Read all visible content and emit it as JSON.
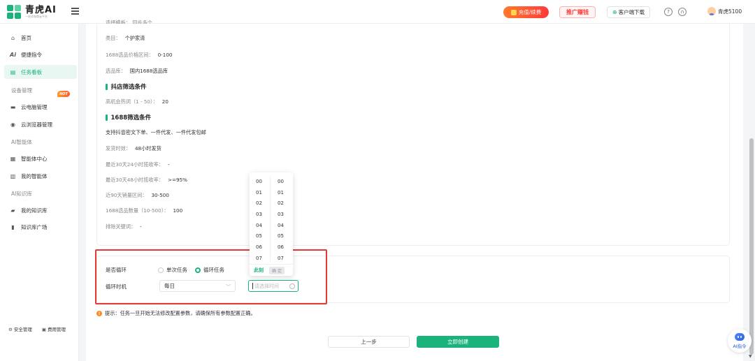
{
  "brand": {
    "title": "青虎AI",
    "subtitle": "一站式电商云平台"
  },
  "topbar": {
    "recharge": "充值/续费",
    "promo": "推广赚钱",
    "download": "客户端下载",
    "user": "青虎5100"
  },
  "sidebar": {
    "items": [
      {
        "label": "首页",
        "icon": "home-icon"
      },
      {
        "label": "便捷指令",
        "icon": "ai-command-icon"
      },
      {
        "label": "任务看板",
        "icon": "task-board-icon",
        "active": true
      }
    ],
    "section_device": "设备管理",
    "device_items": [
      {
        "label": "云电脑管理",
        "icon": "monitor-icon"
      },
      {
        "label": "云浏览器管理",
        "icon": "browser-icon"
      }
    ],
    "hot_badge": "HOT",
    "section_agent": "AI智能体",
    "agent_items": [
      {
        "label": "智能体中心",
        "icon": "grid-icon"
      },
      {
        "label": "我的智能体",
        "icon": "agent-icon"
      }
    ],
    "section_kb": "AI知识库",
    "kb_items": [
      {
        "label": "我的知识库",
        "icon": "folder-icon"
      },
      {
        "label": "知识库广场",
        "icon": "book-icon"
      }
    ],
    "bottom": {
      "security": "安全管理",
      "cost": "费用管理"
    }
  },
  "details": {
    "cut_top": "选择模板：    同步多个",
    "category_label": "类目：",
    "category_value": "个护家清",
    "price_label": "1688选品价格区间：",
    "price_value": "0-100",
    "lib_label": "选品库：",
    "lib_value": "国内1688选品库",
    "douyin_head": "抖店筛选条件",
    "hot_label": "高机会热词（1 - 50）：",
    "hot_value": "20",
    "alibaba_head": "1688筛选条件",
    "support_text": "支持抖音密文下单、一件代发、一件代发包邮",
    "ship_label": "发货时效：",
    "ship_value": "48小时发货",
    "r24_label": "最近30天24小时揽收率：",
    "r24_value": "-",
    "r48_label": "最近30天48小时揽收率：",
    "r48_value": ">=95%",
    "sales_label": "近90天销量区间：",
    "sales_value": "30-500",
    "count_label": "1688选品数量（10-500）：",
    "count_value": "100",
    "exclude_label": "排除关键词：",
    "exclude_value": "-"
  },
  "cycle": {
    "loop_label": "是否循环",
    "option_once": "单次任务",
    "option_loop": "循环任务",
    "selected": "循环任务",
    "time_label": "循环时机",
    "freq_value": "每日",
    "time_placeholder": "请选择时间"
  },
  "picker": {
    "hours": [
      "00",
      "01",
      "02",
      "03",
      "04",
      "05",
      "06",
      "07"
    ],
    "minutes": [
      "00",
      "01",
      "02",
      "03",
      "04",
      "05",
      "06",
      "07"
    ],
    "now": "此刻",
    "ok": "确 定"
  },
  "tip": "提示：任务一旦开始无法修改配置参数，请确保所有参数配置正确。",
  "actions": {
    "prev": "上一步",
    "create": "立即创建"
  },
  "ai_float": "AI指令",
  "colors": {
    "accent": "#19b37b",
    "highlight": "#e53935",
    "recharge": "#ff3b3b"
  }
}
